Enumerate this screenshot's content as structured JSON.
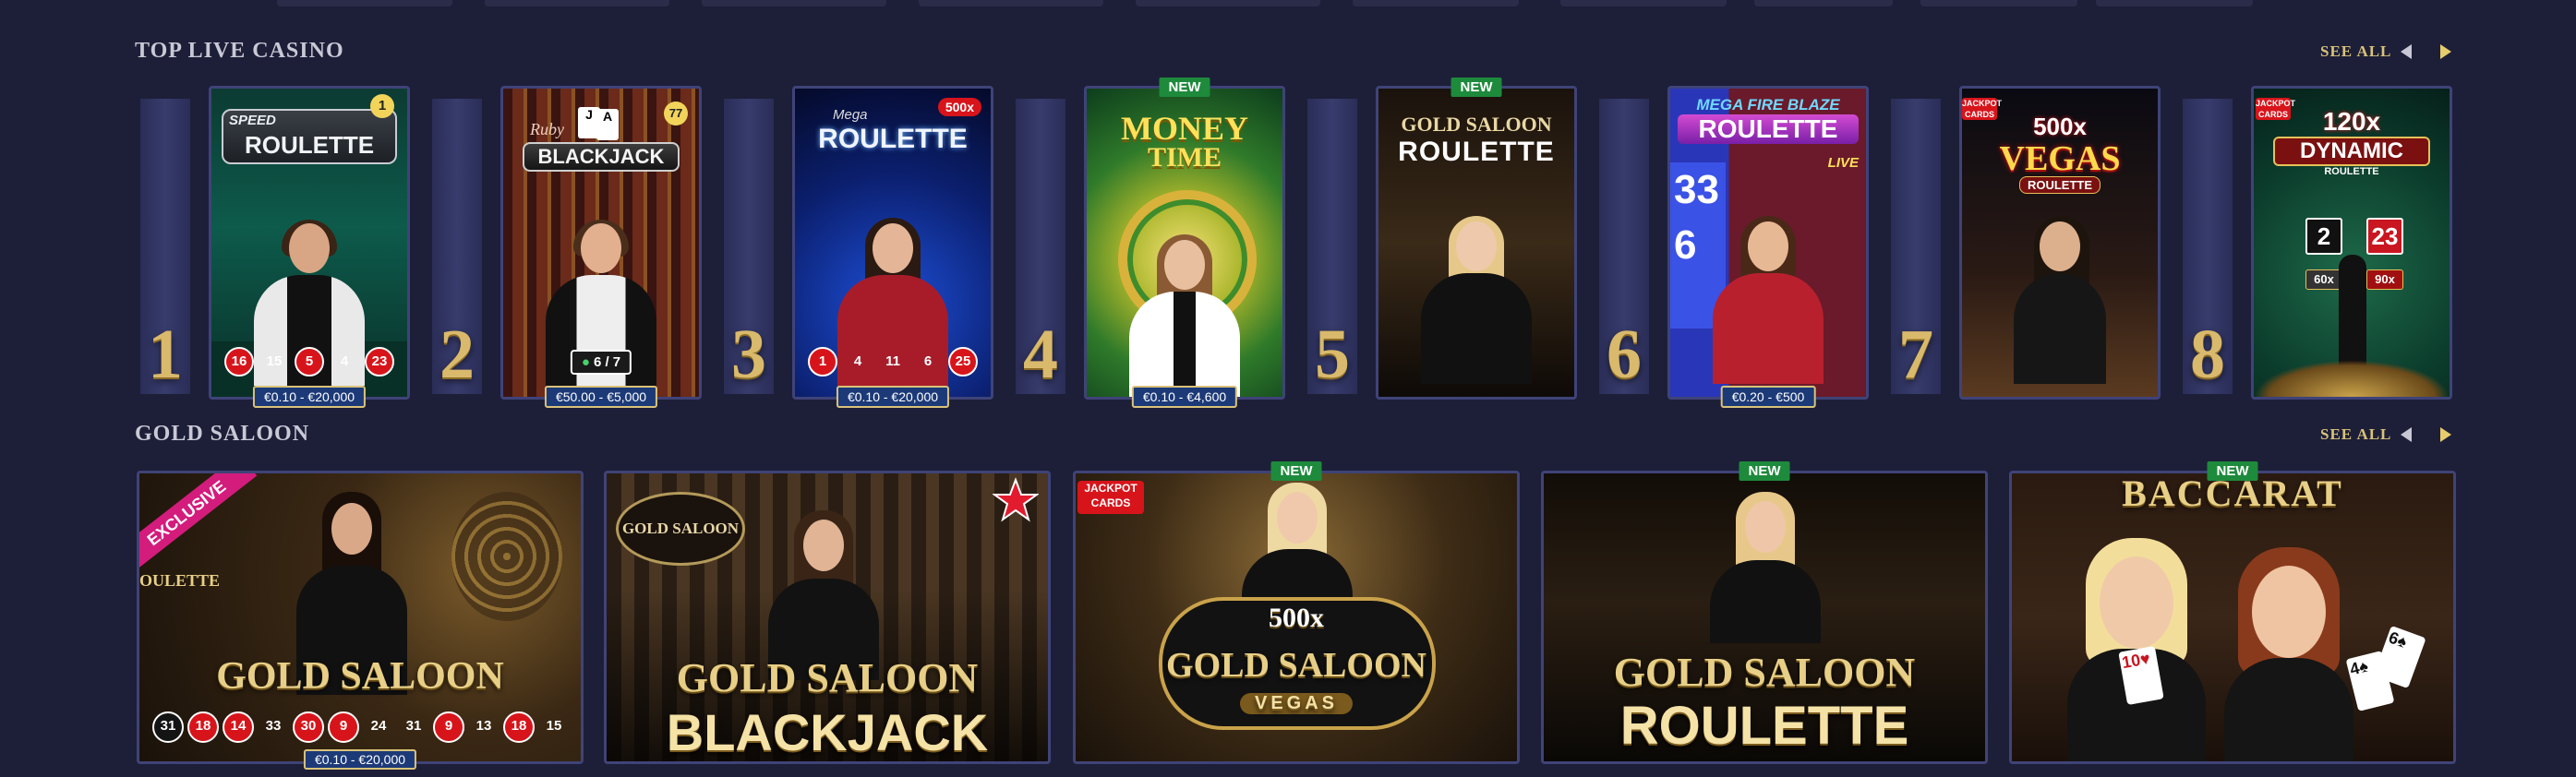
{
  "sections": {
    "top": {
      "title": "TOP LIVE CASINO",
      "see_all": "SEE ALL"
    },
    "gold": {
      "title": "GOLD SALOON",
      "see_all": "SEE ALL"
    }
  },
  "top_games": [
    {
      "rank": "1",
      "logo_small": "SPEED",
      "logo": "ROULETTE",
      "corner": "1",
      "results": [
        "16",
        "15",
        "5",
        "4",
        "23"
      ],
      "limit": "€0.10 - €20,000"
    },
    {
      "rank": "2",
      "logo_small": "Ruby",
      "logo": "BLACKJACK",
      "corner": "77",
      "seats": "6 / 7",
      "limit": "€50.00 - €5,000"
    },
    {
      "rank": "3",
      "logo_small": "Mega",
      "logo": "ROULETTE",
      "corner": "500x",
      "results": [
        "1",
        "4",
        "11",
        "6",
        "25"
      ],
      "limit": "€0.10 - €20,000"
    },
    {
      "rank": "4",
      "logo": "MONEY",
      "logo2": "TIME",
      "badge": "NEW",
      "limit": "€0.10 - €4,600"
    },
    {
      "rank": "5",
      "logo_small": "GOLD SALOON",
      "logo": "ROULETTE",
      "badge": "NEW"
    },
    {
      "rank": "6",
      "logo_small": "MEGA FIRE BLAZE",
      "logo": "ROULETTE",
      "logo_live": "LIVE",
      "limit": "€0.20 - €500"
    },
    {
      "rank": "7",
      "logo_small": "500x",
      "logo": "VEGAS",
      "logo2": "ROULETTE"
    },
    {
      "rank": "8",
      "logo_small": "120x",
      "logo": "DYNAMIC",
      "logo2": "ROULETTE",
      "numbers": [
        "2",
        "23",
        "60x",
        "90x"
      ]
    }
  ],
  "gold_games": [
    {
      "title": "GOLD SALOON",
      "ribbon": "EXCLUSIVE",
      "side_text": "OULETTE",
      "results": [
        "31",
        "18",
        "14",
        "33",
        "30",
        "9",
        "24",
        "31",
        "9",
        "13",
        "18",
        "15"
      ],
      "limit": "€0.10 - €20,000"
    },
    {
      "title": "GOLD SALOON",
      "subtitle": "BLACKJACK",
      "sign": "GOLD SALOON"
    },
    {
      "title": "GOLD SALOON",
      "top": "500x",
      "subtitle": "VEGAS",
      "badge": "NEW"
    },
    {
      "title": "GOLD SALOON",
      "subtitle": "ROULETTE",
      "badge": "NEW"
    },
    {
      "title": "BACCARAT",
      "badge": "NEW"
    }
  ]
}
